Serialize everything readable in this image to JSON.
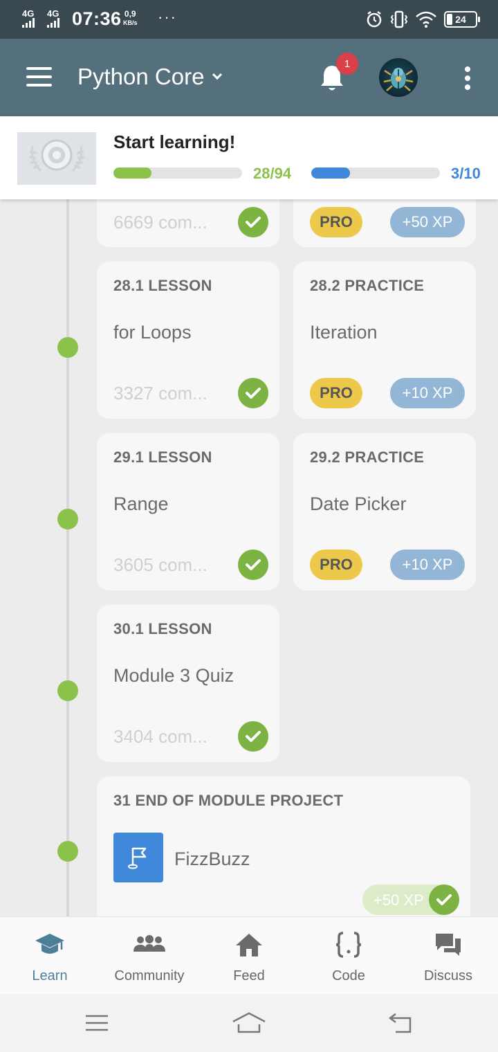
{
  "status_bar": {
    "network_1": "4G",
    "network_2": "4G",
    "time": "07:36",
    "speed_value": "0,9",
    "speed_unit": "KB/s",
    "more": "···",
    "battery": "24"
  },
  "app_bar": {
    "course_title": "Python Core",
    "notification_count": "1"
  },
  "progress": {
    "title": "Start learning!",
    "lessons_label": "28/94",
    "lessons_fraction": 0.298,
    "modules_label": "3/10",
    "modules_fraction": 0.3,
    "lessons_color": "#8bc34a",
    "modules_color": "#3f87d9"
  },
  "top_partial": {
    "comments": "6669 com...",
    "pro_label": "PRO",
    "xp_label": "+50 XP"
  },
  "rows": [
    {
      "lesson": {
        "kicker": "28.1 LESSON",
        "title": "for Loops",
        "comments": "3327 com..."
      },
      "practice": {
        "kicker": "28.2 PRACTICE",
        "title": "Iteration",
        "pro": "PRO",
        "xp": "+10 XP"
      }
    },
    {
      "lesson": {
        "kicker": "29.1 LESSON",
        "title": "Range",
        "comments": "3605 com..."
      },
      "practice": {
        "kicker": "29.2 PRACTICE",
        "title": "Date Picker",
        "pro": "PRO",
        "xp": "+10 XP"
      }
    },
    {
      "lesson": {
        "kicker": "30.1 LESSON",
        "title": "Module 3 Quiz",
        "comments": "3404 com..."
      }
    }
  ],
  "project": {
    "kicker": "31 END OF MODULE PROJECT",
    "title": "FizzBuzz",
    "xp": "+50 XP"
  },
  "bottom_nav": [
    {
      "label": "Learn",
      "icon": "graduation-cap-icon",
      "active": true
    },
    {
      "label": "Community",
      "icon": "people-icon",
      "active": false
    },
    {
      "label": "Feed",
      "icon": "home-icon",
      "active": false
    },
    {
      "label": "Code",
      "icon": "braces-icon",
      "active": false
    },
    {
      "label": "Discuss",
      "icon": "chat-bubbles-icon",
      "active": false
    }
  ],
  "colors": {
    "status_bar": "#3a4850",
    "app_bar": "#54707d",
    "check_green": "#7cb342",
    "pro_yellow": "#ecc94b",
    "xp_blue": "#93b5d6",
    "active_nav": "#4e7f98"
  }
}
